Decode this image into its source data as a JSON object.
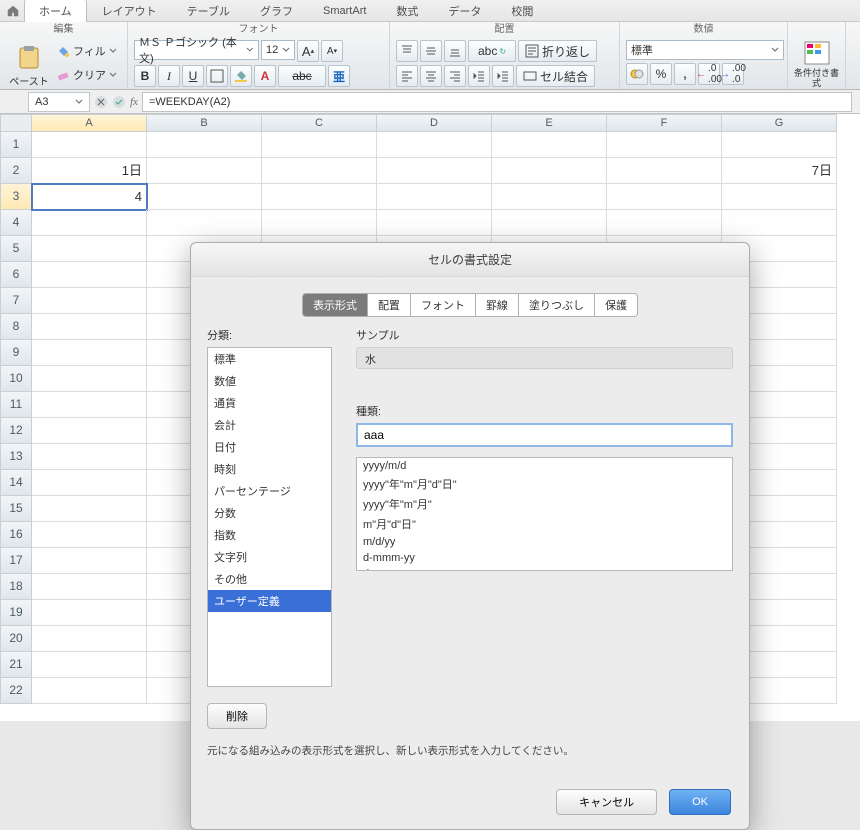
{
  "ribbon_tabs": [
    "ホーム",
    "レイアウト",
    "テーブル",
    "グラフ",
    "SmartArt",
    "数式",
    "データ",
    "校閲"
  ],
  "active_tab": 0,
  "groups": {
    "edit": {
      "title": "編集",
      "paste": "ペースト",
      "fill": "フィル",
      "clear": "クリア"
    },
    "font": {
      "title": "フォント",
      "name": "ＭＳ Ｐゴシック (本文)",
      "size": "12",
      "bold": "B",
      "italic": "I",
      "underline": "U",
      "abc": "abc",
      "ruby": "A"
    },
    "align": {
      "title": "配置",
      "wrap": "折り返し",
      "merge": "セル結合",
      "abc": "abc"
    },
    "number": {
      "title": "数値",
      "format": "標準",
      "percent": "%",
      "comma": ",",
      "dec_inc": ".0",
      "dec_dec": ".00"
    },
    "cond": {
      "label": "条件付き書式"
    }
  },
  "namebox": "A3",
  "formula": "=WEEKDAY(A2)",
  "columns": [
    "A",
    "B",
    "C",
    "D",
    "E",
    "F",
    "G"
  ],
  "rows": [
    "1",
    "2",
    "3",
    "4",
    "5",
    "6",
    "7",
    "8",
    "9",
    "10",
    "11",
    "12",
    "13",
    "14",
    "15",
    "16",
    "17",
    "18",
    "19",
    "20",
    "21",
    "22"
  ],
  "cells": {
    "A2": "1日",
    "A3": "4",
    "G2": "7日"
  },
  "dialog": {
    "title": "セルの書式設定",
    "tabs": [
      "表示形式",
      "配置",
      "フォント",
      "罫線",
      "塗りつぶし",
      "保護"
    ],
    "active_tab": 0,
    "category_label": "分類:",
    "categories": [
      "標準",
      "数値",
      "通貨",
      "会計",
      "日付",
      "時刻",
      "パーセンテージ",
      "分数",
      "指数",
      "文字列",
      "その他",
      "ユーザー定義"
    ],
    "selected_category": 11,
    "sample_label": "サンプル",
    "sample_value": "水",
    "type_label": "種類:",
    "type_value": "aaa",
    "type_list": [
      "yyyy/m/d",
      "yyyy\"年\"m\"月\"d\"日\"",
      "yyyy\"年\"m\"月\"",
      "m\"月\"d\"日\"",
      "m/d/yy",
      "d-mmm-yy",
      "d-mmm"
    ],
    "delete": "削除",
    "hint": "元になる組み込みの表示形式を選択し、新しい表示形式を入力してください。",
    "cancel": "キャンセル",
    "ok": "OK"
  }
}
